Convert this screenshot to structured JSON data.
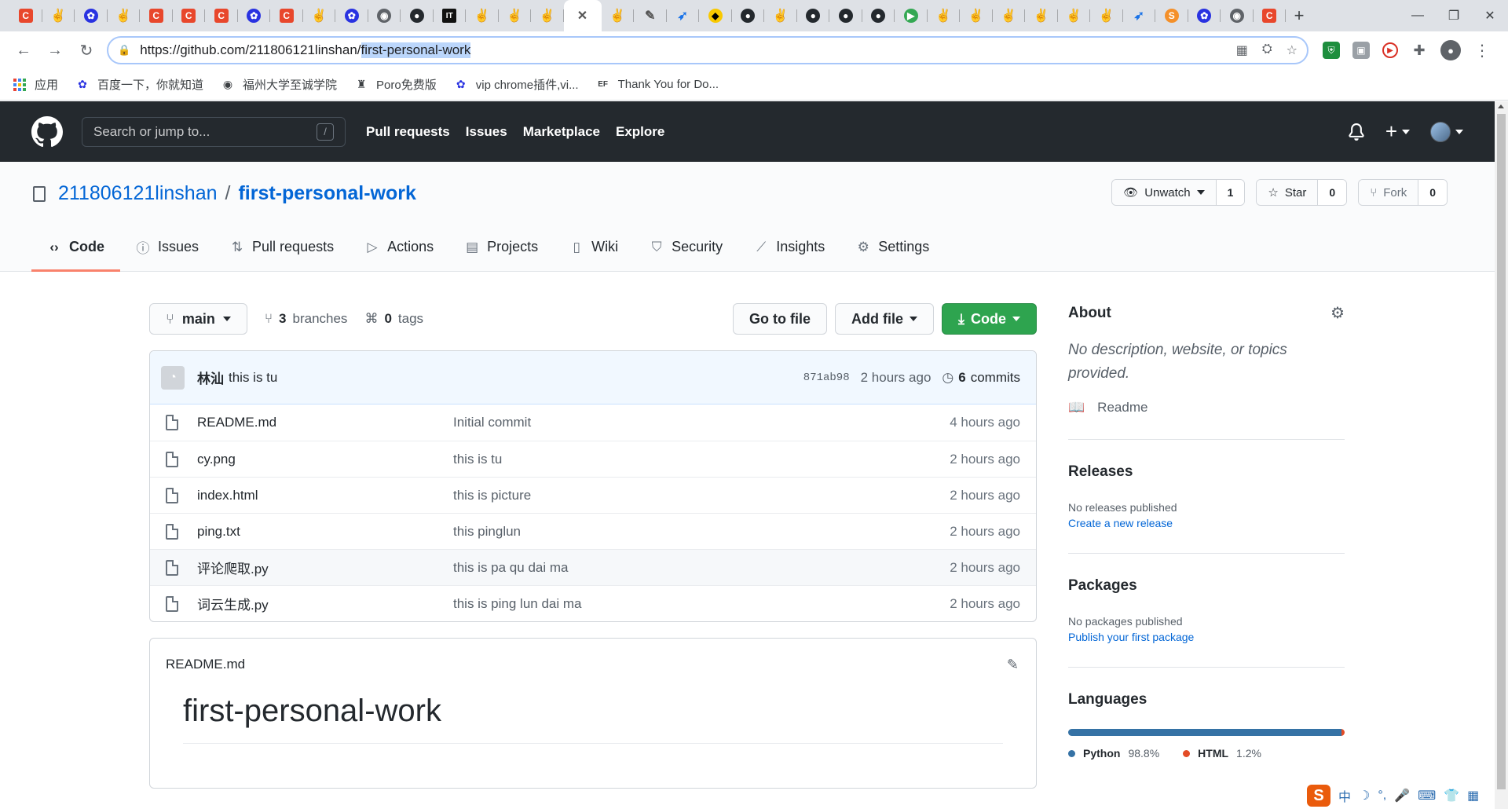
{
  "browser": {
    "tabs": [
      {
        "icon": "csdn-icon",
        "glyph": "C",
        "style": "red"
      },
      {
        "icon": "hand-icon",
        "glyph": "✌",
        "style": "hand"
      },
      {
        "icon": "baidu-icon",
        "glyph": "✿",
        "style": "baidu"
      },
      {
        "icon": "hand-icon",
        "glyph": "✌",
        "style": "hand"
      },
      {
        "icon": "csdn-icon",
        "glyph": "C",
        "style": "red"
      },
      {
        "icon": "csdn-icon",
        "glyph": "C",
        "style": "red"
      },
      {
        "icon": "csdn-icon",
        "glyph": "C",
        "style": "red"
      },
      {
        "icon": "baidu-icon",
        "glyph": "✿",
        "style": "baidu"
      },
      {
        "icon": "csdn-icon",
        "glyph": "C",
        "style": "red"
      },
      {
        "icon": "hand-icon",
        "glyph": "✌",
        "style": "hand"
      },
      {
        "icon": "baidu-icon",
        "glyph": "✿",
        "style": "baidu"
      },
      {
        "icon": "globe-icon",
        "glyph": "◉",
        "style": "gray"
      },
      {
        "icon": "github-icon",
        "glyph": "●",
        "style": "github"
      },
      {
        "icon": "it-icon",
        "glyph": "IT",
        "style": "it"
      },
      {
        "icon": "hand-icon",
        "glyph": "✌",
        "style": "hand"
      },
      {
        "icon": "hand-icon",
        "glyph": "✌",
        "style": "hand"
      },
      {
        "icon": "hand-icon",
        "glyph": "✌",
        "style": "hand"
      },
      {
        "icon": "close-icon",
        "glyph": "✕",
        "style": "active"
      },
      {
        "icon": "hand-icon",
        "glyph": "✌",
        "style": "hand"
      },
      {
        "icon": "brush-icon",
        "glyph": "✎",
        "style": "hand"
      },
      {
        "icon": "rocket-icon",
        "glyph": "➶",
        "style": "rocket"
      },
      {
        "icon": "batman-icon",
        "glyph": "◆",
        "style": "bat"
      },
      {
        "icon": "github-icon",
        "glyph": "●",
        "style": "github"
      },
      {
        "icon": "hand-icon",
        "glyph": "✌",
        "style": "hand"
      },
      {
        "icon": "github-icon",
        "glyph": "●",
        "style": "github"
      },
      {
        "icon": "github-icon",
        "glyph": "●",
        "style": "github"
      },
      {
        "icon": "github-icon",
        "glyph": "●",
        "style": "github"
      },
      {
        "icon": "play-icon",
        "glyph": "▶",
        "style": "play"
      },
      {
        "icon": "hand-icon",
        "glyph": "✌",
        "style": "hand"
      },
      {
        "icon": "hand-icon",
        "glyph": "✌",
        "style": "hand"
      },
      {
        "icon": "hand-icon",
        "glyph": "✌",
        "style": "hand"
      },
      {
        "icon": "hand-icon",
        "glyph": "✌",
        "style": "hand"
      },
      {
        "icon": "hand-icon",
        "glyph": "✌",
        "style": "hand"
      },
      {
        "icon": "hand-icon",
        "glyph": "✌",
        "style": "hand"
      },
      {
        "icon": "rocket-icon",
        "glyph": "➶",
        "style": "rocket"
      },
      {
        "icon": "s-icon",
        "glyph": "S",
        "style": "sfont"
      },
      {
        "icon": "baidu-icon",
        "glyph": "✿",
        "style": "baidu"
      },
      {
        "icon": "globe-icon",
        "glyph": "◉",
        "style": "gray"
      },
      {
        "icon": "csdn-icon",
        "glyph": "C",
        "style": "red"
      }
    ],
    "url_base": "https://github.com/211806121linshan/",
    "url_selected": "first-personal-work",
    "bookmarks": [
      {
        "label": "应用",
        "icon": "apps-icon"
      },
      {
        "label": "百度一下，你就知道",
        "icon": "baidu-icon"
      },
      {
        "label": "福州大学至诚学院",
        "icon": "globe-icon"
      },
      {
        "label": "Poro免费版",
        "icon": "poro-icon"
      },
      {
        "label": "vip chrome插件,vi...",
        "icon": "baidu-icon"
      },
      {
        "label": "Thank You for Do...",
        "icon": "ef-icon"
      }
    ]
  },
  "github": {
    "search_placeholder": "Search or jump to...",
    "search_shortcut": "/",
    "nav": [
      "Pull requests",
      "Issues",
      "Marketplace",
      "Explore"
    ]
  },
  "repo": {
    "owner": "211806121linshan",
    "separator": "/",
    "name": "first-personal-work",
    "watch_label": "Unwatch",
    "watch_count": "1",
    "star_label": "Star",
    "star_count": "0",
    "fork_label": "Fork",
    "fork_count": "0",
    "tabs": [
      {
        "label": "Code",
        "icon": "code-icon",
        "glyph": "‹›"
      },
      {
        "label": "Issues",
        "icon": "issue-icon",
        "glyph": "ⓘ"
      },
      {
        "label": "Pull requests",
        "icon": "pull-request-icon",
        "glyph": "⇅"
      },
      {
        "label": "Actions",
        "icon": "actions-icon",
        "glyph": "▷"
      },
      {
        "label": "Projects",
        "icon": "projects-icon",
        "glyph": "▤"
      },
      {
        "label": "Wiki",
        "icon": "wiki-icon",
        "glyph": "▯"
      },
      {
        "label": "Security",
        "icon": "shield-icon",
        "glyph": "⛉"
      },
      {
        "label": "Insights",
        "icon": "graph-icon",
        "glyph": "⟋"
      },
      {
        "label": "Settings",
        "icon": "gear-icon",
        "glyph": "⚙"
      }
    ]
  },
  "code": {
    "branch": "main",
    "branches_count": "3",
    "branches_label": "branches",
    "tags_count": "0",
    "tags_label": "tags",
    "goto_file": "Go to file",
    "add_file": "Add file",
    "code_button": "Code",
    "commit": {
      "author": "林汕",
      "message": "this is tu",
      "sha": "871ab98",
      "time": "2 hours ago",
      "commits_count": "6",
      "commits_label": "commits"
    },
    "files": [
      {
        "name": "README.md",
        "message": "Initial commit",
        "time": "4 hours ago"
      },
      {
        "name": "cy.png",
        "message": "this is tu",
        "time": "2 hours ago"
      },
      {
        "name": "index.html",
        "message": "this is picture",
        "time": "2 hours ago"
      },
      {
        "name": "ping.txt",
        "message": "this pinglun",
        "time": "2 hours ago"
      },
      {
        "name": "评论爬取.py",
        "message": "this is pa qu dai ma",
        "time": "2 hours ago"
      },
      {
        "name": "词云生成.py",
        "message": "this is ping lun dai ma",
        "time": "2 hours ago"
      }
    ],
    "readme_file": "README.md",
    "readme_heading": "first-personal-work"
  },
  "sidebar": {
    "about_title": "About",
    "about_desc": "No description, website, or topics provided.",
    "readme_label": "Readme",
    "releases_title": "Releases",
    "releases_none": "No releases published",
    "releases_link": "Create a new release",
    "packages_title": "Packages",
    "packages_none": "No packages published",
    "packages_link": "Publish your first package",
    "languages_title": "Languages",
    "languages": [
      {
        "name": "Python",
        "percent": "98.8%",
        "value": 98.8,
        "color": "#3572a5"
      },
      {
        "name": "HTML",
        "percent": "1.2%",
        "value": 1.2,
        "color": "#e34c26"
      }
    ]
  },
  "ime": {
    "lang": "中",
    "items": [
      "☽",
      "°,",
      "🎤",
      "⌨",
      "👕",
      "▦"
    ]
  }
}
